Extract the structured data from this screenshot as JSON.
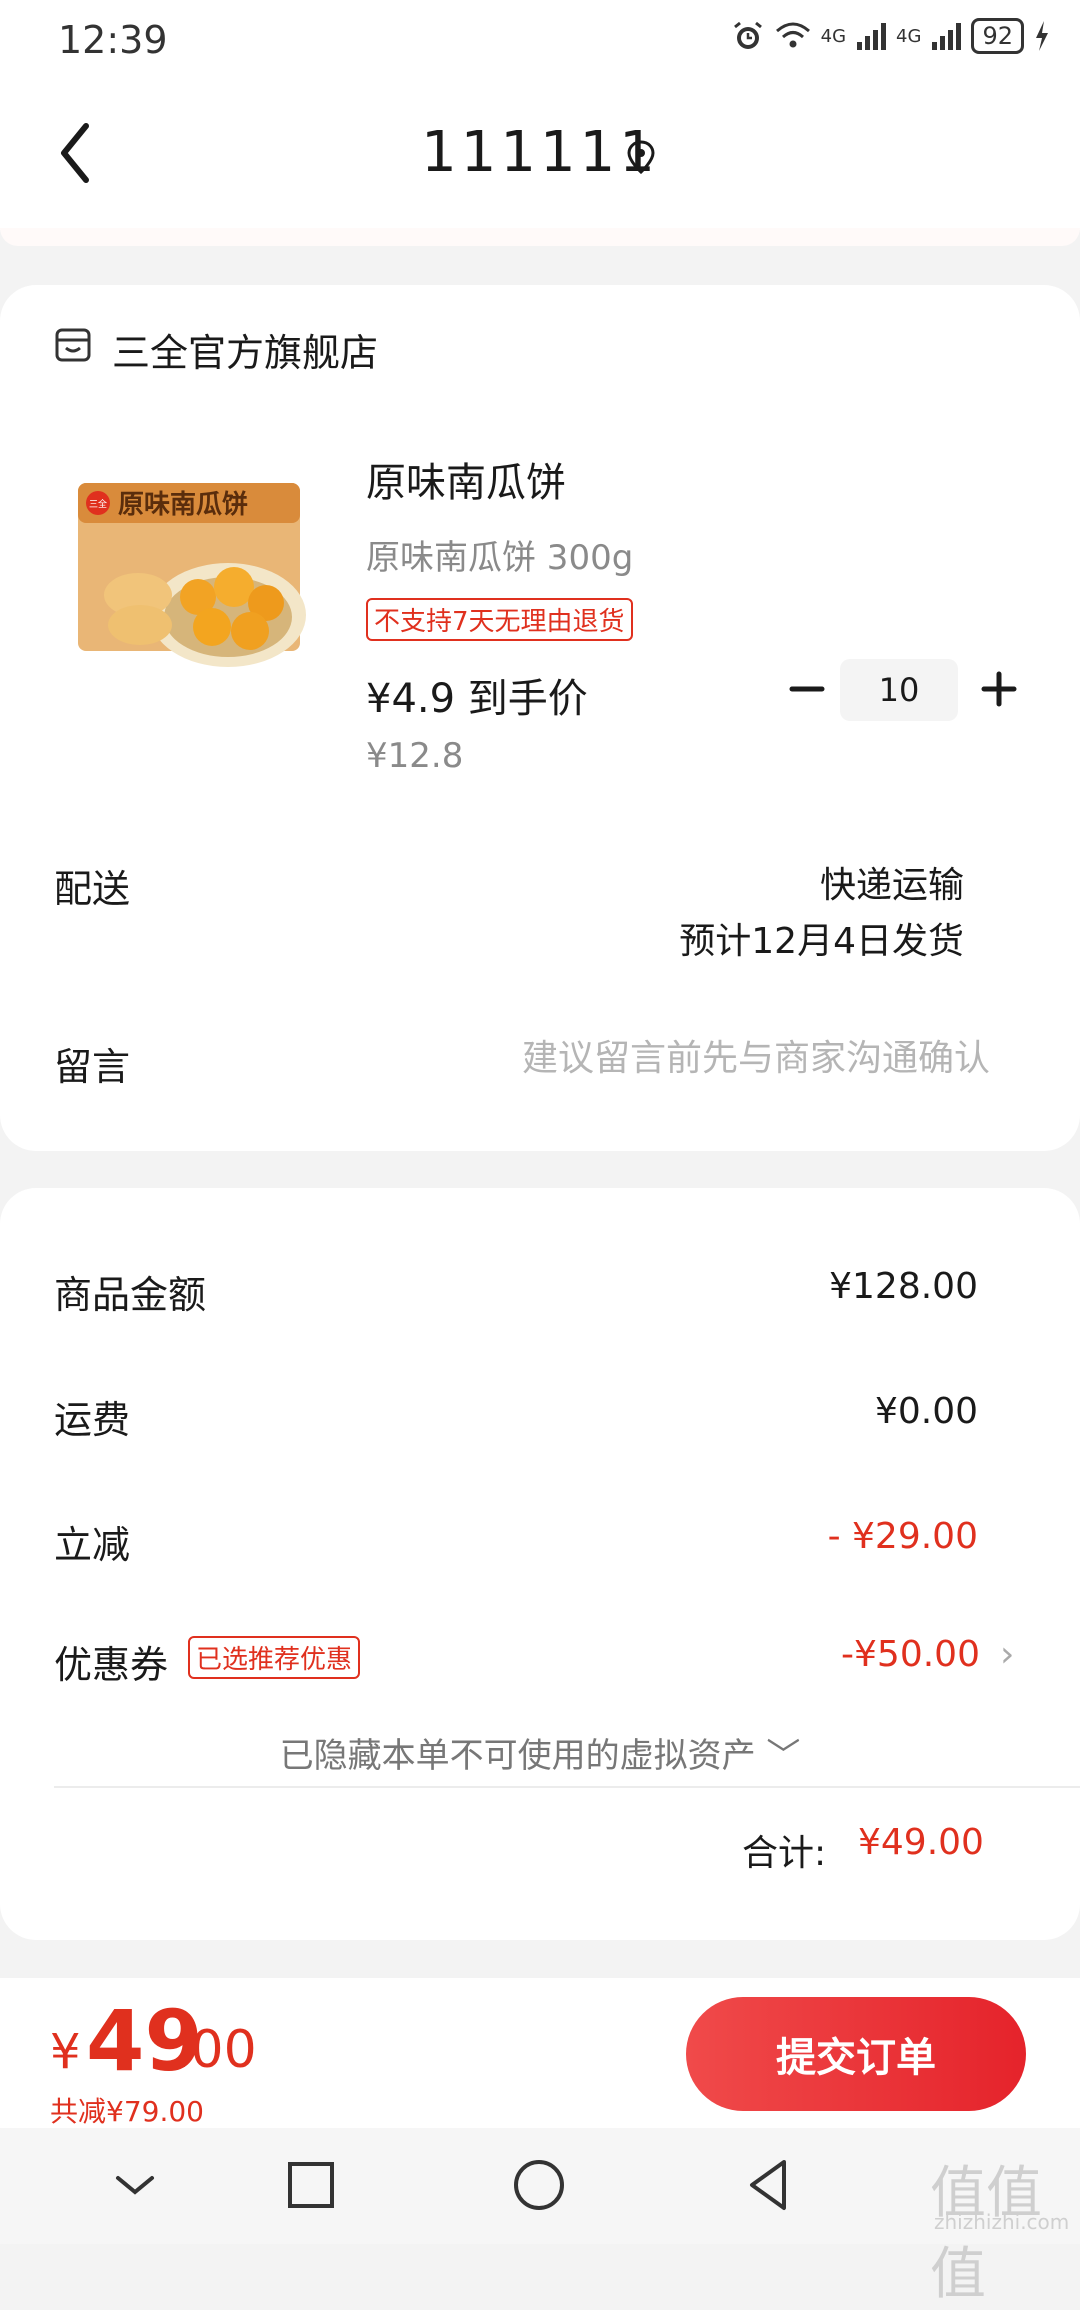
{
  "status_bar": {
    "time": "12:39",
    "signal1": "4G",
    "signal2": "4G",
    "battery": "92"
  },
  "header": {
    "title": "111111"
  },
  "store": {
    "name": "三全官方旗舰店"
  },
  "product": {
    "title": "原味南瓜饼",
    "spec": "原味南瓜饼 300g",
    "return_tag": "不支持7天无理由退货",
    "price_label": "¥4.9 到手价",
    "original_price": "¥12.8",
    "quantity": "10",
    "image_brand": "三全",
    "image_label": "原味南瓜饼"
  },
  "delivery": {
    "label": "配送",
    "method": "快递运输",
    "eta": "预计12月4日发货"
  },
  "message": {
    "label": "留言",
    "placeholder": "建议留言前先与商家沟通确认"
  },
  "summary": {
    "goods_label": "商品金额",
    "goods_value": "¥128.00",
    "shipping_label": "运费",
    "shipping_value": "¥0.00",
    "discount_label": "立减",
    "discount_value": "- ¥29.00",
    "coupon_label": "优惠券",
    "coupon_tag": "已选推荐优惠",
    "coupon_value": "-¥50.00",
    "hidden_assets": "已隐藏本单不可使用的虚拟资产 ﹀",
    "total_label": "合计:",
    "total_value": "¥49.00"
  },
  "bottom_bar": {
    "currency": "¥",
    "pay_integer": "49",
    "pay_decimal": ".00",
    "saved": "共减¥79.00",
    "submit_label": "提交订单"
  },
  "watermark": {
    "main": "值值值",
    "sub": "zhizhizhi.com"
  },
  "colors": {
    "accent": "#e0301e",
    "button": "#ee3b3b",
    "background": "#f3f3f3"
  }
}
